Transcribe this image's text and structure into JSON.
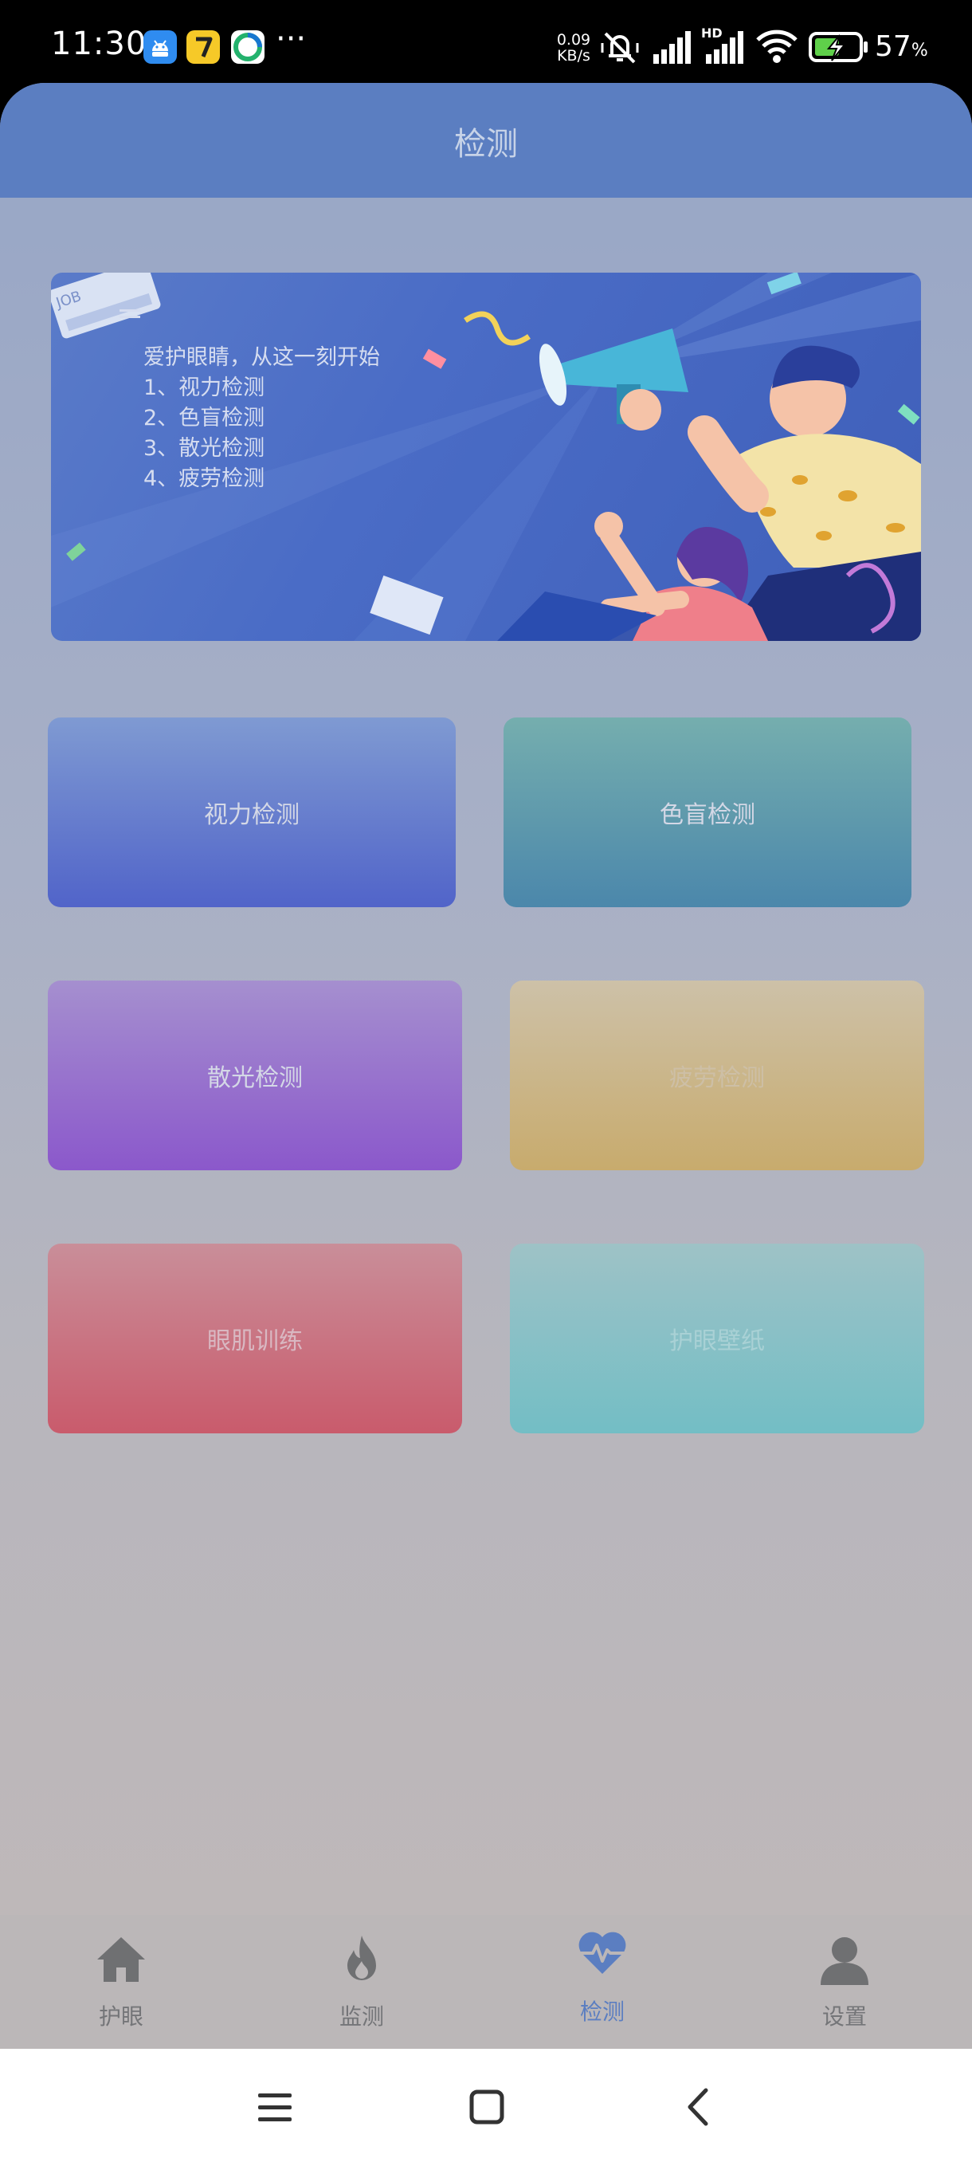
{
  "status_bar": {
    "time": "11:30",
    "more": "···",
    "net_speed_value": "0.09",
    "net_speed_unit": "KB/s",
    "signal_badge": "HD",
    "battery_percent": "57",
    "battery_unit": "%",
    "app_icons": [
      "android-app-icon",
      "number-7-app-icon",
      "green-swirl-app-icon"
    ]
  },
  "header": {
    "title": "检测"
  },
  "banner": {
    "lines": [
      "爱护眼睛，从这一刻开始",
      "1、视力检测",
      "2、色盲检测",
      "3、散光检测",
      "4、疲劳检测"
    ],
    "sticker_text": "JOB"
  },
  "tiles": {
    "vision": "视力检测",
    "color_blind": "色盲检测",
    "astigmatism": "散光检测",
    "fatigue": "疲劳检测",
    "eye_training": "眼肌训练",
    "wallpaper": "护眼壁纸"
  },
  "tab_bar": {
    "active": "检测",
    "items": [
      {
        "label": "护眼",
        "icon": "home-icon"
      },
      {
        "label": "监测",
        "icon": "flame-icon"
      },
      {
        "label": "检测",
        "icon": "heartbeat-icon"
      },
      {
        "label": "设置",
        "icon": "person-icon"
      }
    ]
  },
  "colors": {
    "accent": "#5b7ec1",
    "tab_inactive": "#747578"
  }
}
